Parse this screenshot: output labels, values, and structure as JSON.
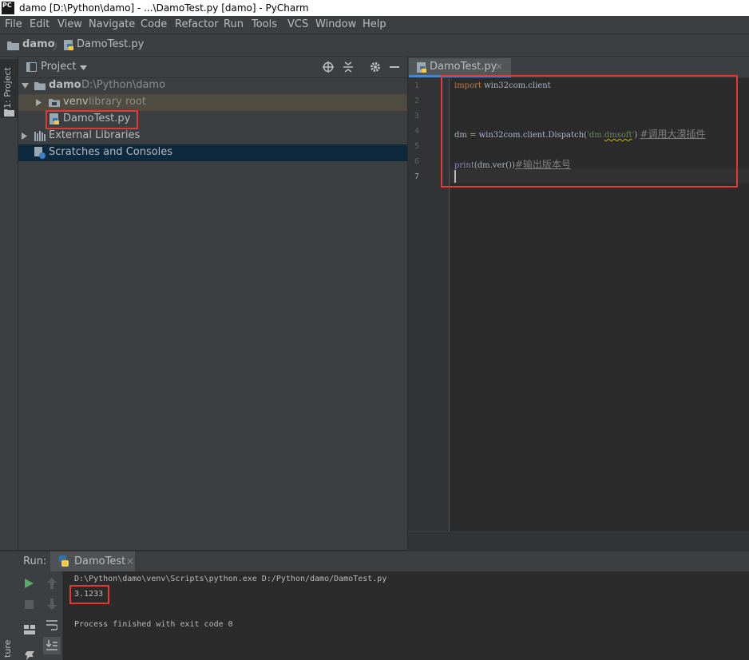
{
  "window": {
    "app_icon_text": "PC",
    "title": "damo [D:\\Python\\damo] - ...\\DamoTest.py [damo] - PyCharm"
  },
  "menu": [
    "File",
    "Edit",
    "View",
    "Navigate",
    "Code",
    "Refactor",
    "Run",
    "Tools",
    "VCS",
    "Window",
    "Help"
  ],
  "breadcrumb": {
    "project": "damo",
    "file": "DamoTest.py"
  },
  "left_strip": {
    "project_tab": "1: Project",
    "bottom_label": "ture"
  },
  "project_panel": {
    "title": "Project",
    "tree": {
      "root_name": "damo",
      "root_path": "D:\\Python\\damo",
      "venv_name": "venv",
      "venv_note": "library root",
      "file": "DamoTest.py",
      "external": "External Libraries",
      "scratches": "Scratches and Consoles"
    }
  },
  "editor": {
    "tab_label": "DamoTest.py",
    "tab_close": "×",
    "line_numbers": [
      "1",
      "2",
      "3",
      "4",
      "5",
      "6",
      "7"
    ],
    "code": {
      "line1_kw": "import",
      "line1_rest": " win32com.client",
      "line4_a": "dm = win32com.client.Dispatch(",
      "line4_str_q1": "'",
      "line4_str_a": "dm.",
      "line4_str_b": "dmsoft",
      "line4_str_q2": "'",
      "line4_b": ")  ",
      "line4_cmt": "#调用大漠插件",
      "line6_fn": "print",
      "line6_a": "(dm.ver())",
      "line6_cmt": "#输出版本号"
    }
  },
  "run_panel": {
    "label": "Run:",
    "tab": "DamoTest",
    "tab_close": "×",
    "console": {
      "line1": "D:\\Python\\damo\\venv\\Scripts\\python.exe D:/Python/damo/DamoTest.py",
      "line2": "3.1233",
      "line3": "Process finished with exit code 0"
    }
  },
  "colors": {
    "accent_blue": "#4a88c7",
    "highlight_red": "#e53935",
    "selection": "#0d293e",
    "venv_row": "#4f4b41"
  }
}
